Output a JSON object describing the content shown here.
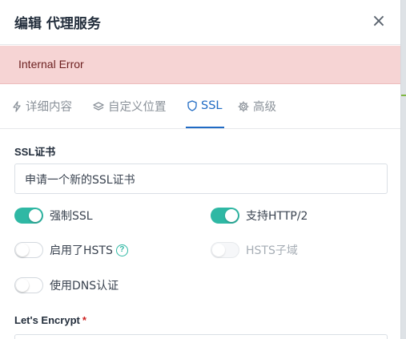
{
  "modal": {
    "title": "编辑 代理服务",
    "close_label": "×"
  },
  "alert": {
    "message": "Internal Error"
  },
  "tabs": [
    {
      "label": "详细内容",
      "icon": "bolt-icon",
      "active": false
    },
    {
      "label": "自定义位置",
      "icon": "layers-icon",
      "active": false
    },
    {
      "label": "SSL",
      "icon": "shield-icon",
      "active": true
    },
    {
      "label": "高级",
      "icon": "gear-icon",
      "active": false
    }
  ],
  "ssl": {
    "cert_label": "SSL证书",
    "cert_value": "申请一个新的SSL证书",
    "force_ssl": {
      "label": "强制SSL",
      "on": true
    },
    "http2": {
      "label": "支持HTTP/2",
      "on": true
    },
    "hsts": {
      "label": "启用了HSTS",
      "on": false,
      "help": "?"
    },
    "hsts_sub": {
      "label": "HSTS子域",
      "on": false,
      "disabled": true
    },
    "dns": {
      "label": "使用DNS认证",
      "on": false
    },
    "lets_encrypt_label": "Let's Encrypt",
    "required_mark": "*"
  },
  "colors": {
    "accent": "#206bc4",
    "toggle_on": "#2fb8a4",
    "alert_bg": "#f6d4d4"
  }
}
